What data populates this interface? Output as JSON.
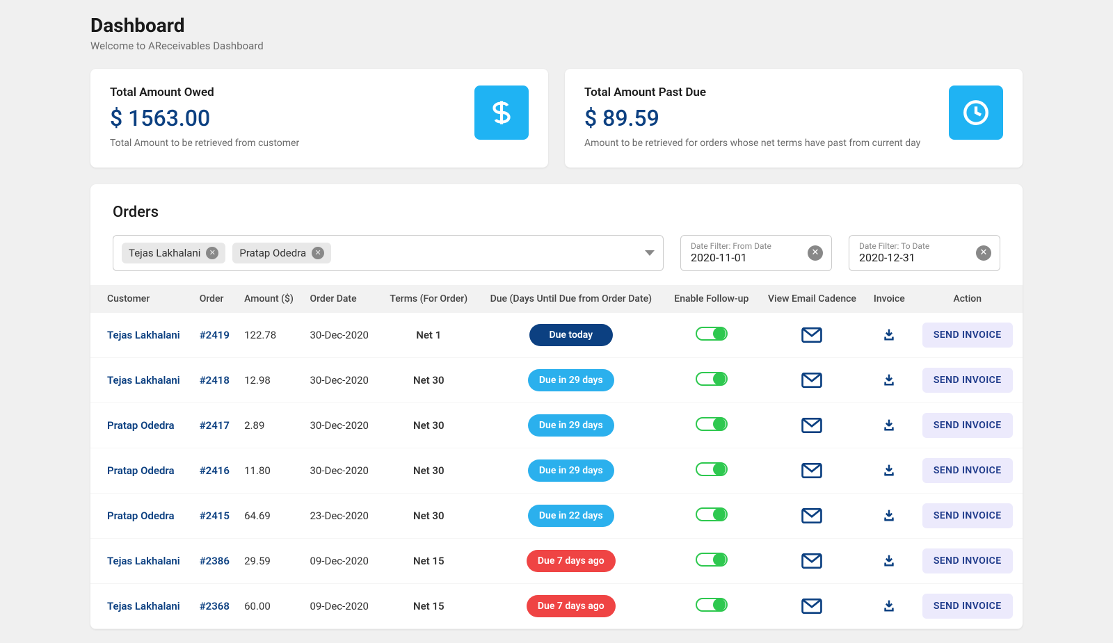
{
  "header": {
    "title": "Dashboard",
    "subtitle": "Welcome to AReceivables Dashboard"
  },
  "cards": {
    "owed": {
      "title": "Total Amount Owed",
      "value": "$ 1563.00",
      "desc": "Total Amount to be retrieved from customer"
    },
    "pastdue": {
      "title": "Total Amount Past Due",
      "value": "$ 89.59",
      "desc": "Amount to be retrieved for orders whose net terms have past from current day"
    }
  },
  "orders": {
    "title": "Orders",
    "chips": {
      "a": "Tejas Lakhalani",
      "b": "Pratap Odedra"
    },
    "dateFrom": {
      "label": "Date Filter: From Date",
      "value": "2020-11-01"
    },
    "dateTo": {
      "label": "Date Filter: To Date",
      "value": "2020-12-31"
    },
    "columns": {
      "customer": "Customer",
      "order": "Order",
      "amount": "Amount ($)",
      "orderDate": "Order Date",
      "terms": "Terms (For Order)",
      "due": "Due (Days Until Due from Order Date)",
      "followup": "Enable Follow-up",
      "cadence": "View Email Cadence",
      "invoice": "Invoice",
      "action": "Action"
    },
    "action_label": "SEND INVOICE",
    "rows": [
      {
        "customer": "Tejas Lakhalani",
        "order": "#2419",
        "amount": "122.78",
        "date": "30-Dec-2020",
        "terms": "Net 1",
        "due": "Due today",
        "dueClass": "due-dark"
      },
      {
        "customer": "Tejas Lakhalani",
        "order": "#2418",
        "amount": "12.98",
        "date": "30-Dec-2020",
        "terms": "Net 30",
        "due": "Due in 29 days",
        "dueClass": "due-blue"
      },
      {
        "customer": "Pratap Odedra",
        "order": "#2417",
        "amount": "2.89",
        "date": "30-Dec-2020",
        "terms": "Net 30",
        "due": "Due in 29 days",
        "dueClass": "due-blue"
      },
      {
        "customer": "Pratap Odedra",
        "order": "#2416",
        "amount": "11.80",
        "date": "30-Dec-2020",
        "terms": "Net 30",
        "due": "Due in 29 days",
        "dueClass": "due-blue"
      },
      {
        "customer": "Pratap Odedra",
        "order": "#2415",
        "amount": "64.69",
        "date": "23-Dec-2020",
        "terms": "Net 30",
        "due": "Due in 22 days",
        "dueClass": "due-blue"
      },
      {
        "customer": "Tejas Lakhalani",
        "order": "#2386",
        "amount": "29.59",
        "date": "09-Dec-2020",
        "terms": "Net 15",
        "due": "Due 7 days ago",
        "dueClass": "due-red"
      },
      {
        "customer": "Tejas Lakhalani",
        "order": "#2368",
        "amount": "60.00",
        "date": "09-Dec-2020",
        "terms": "Net 15",
        "due": "Due 7 days ago",
        "dueClass": "due-red"
      }
    ]
  }
}
